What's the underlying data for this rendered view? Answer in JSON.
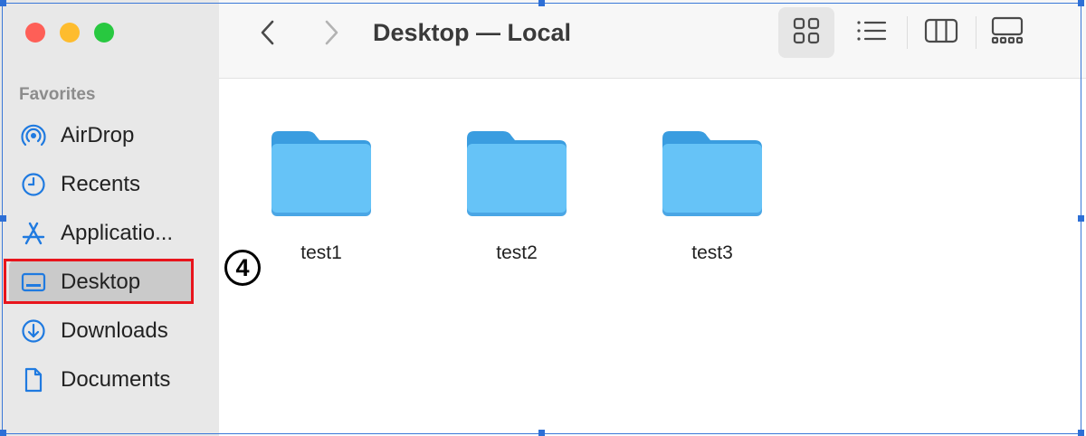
{
  "sidebar": {
    "section_label": "Favorites",
    "items": [
      {
        "label": "AirDrop",
        "icon": "airdrop-icon"
      },
      {
        "label": "Recents",
        "icon": "clock-icon"
      },
      {
        "label": "Applicatio...",
        "icon": "applications-icon"
      },
      {
        "label": "Desktop",
        "icon": "desktop-icon",
        "selected": true
      },
      {
        "label": "Downloads",
        "icon": "download-icon"
      },
      {
        "label": "Documents",
        "icon": "document-icon"
      }
    ]
  },
  "toolbar": {
    "title": "Desktop — Local",
    "view_modes": [
      "icon-view",
      "list-view",
      "column-view",
      "gallery-view"
    ],
    "active_view": "icon-view"
  },
  "files": [
    {
      "name": "test1",
      "icon": "folder-icon"
    },
    {
      "name": "test2",
      "icon": "folder-icon"
    },
    {
      "name": "test3",
      "icon": "folder-icon"
    }
  ],
  "annotation": {
    "step_marker": "4",
    "highlight_color": "#e8141c"
  },
  "colors": {
    "accent": "#1f7ae0",
    "folder": "#5cc0f5",
    "selection_frame": "#3a78d8"
  }
}
